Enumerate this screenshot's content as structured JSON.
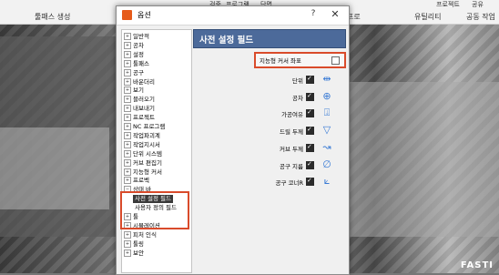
{
  "background": {
    "ribbon": {
      "group_left": "툴패스 생성",
      "tabs_top": [
        "검증",
        "프로그램",
        "단면"
      ],
      "group_mid": "프로",
      "group_right": "유틸리티",
      "right_top": "프로젝트",
      "right_top2": "공유",
      "group_far_right": "공동 작업"
    },
    "logo": "FASTI"
  },
  "dialog": {
    "title": "옵션",
    "help_label": "?",
    "close_label": "✕",
    "tree": {
      "items": [
        {
          "label": "일반적",
          "expander": "+"
        },
        {
          "label": "공차",
          "expander": "+"
        },
        {
          "label": "설정",
          "expander": "+"
        },
        {
          "label": "툴패스",
          "expander": "+"
        },
        {
          "label": "공구",
          "expander": "+"
        },
        {
          "label": "바운더리",
          "expander": "+"
        },
        {
          "label": "보기",
          "expander": "+"
        },
        {
          "label": "블러오기",
          "expander": "+"
        },
        {
          "label": "내보내기",
          "expander": "+"
        },
        {
          "label": "프로젝트",
          "expander": "+"
        },
        {
          "label": "NC 프로그램",
          "expander": "+"
        },
        {
          "label": "작업파괴계",
          "expander": "+"
        },
        {
          "label": "작업지시서",
          "expander": "+"
        },
        {
          "label": "단위 시스템",
          "expander": "+"
        },
        {
          "label": "커브 편집기",
          "expander": "+"
        },
        {
          "label": "지능형 커서",
          "expander": "+"
        },
        {
          "label": "프로벡",
          "expander": "+"
        },
        {
          "label": "상태 바",
          "expander": "−"
        }
      ],
      "status_children": [
        "사전 설정 필드",
        "사용자 정의 필드"
      ],
      "after_items": [
        {
          "label": "툴",
          "expander": "+"
        },
        {
          "label": "시뮬레이션",
          "expander": "+"
        },
        {
          "label": "피처 인식",
          "expander": "+"
        },
        {
          "label": "툴링",
          "expander": "+"
        },
        {
          "label": "보안",
          "expander": "+"
        }
      ]
    },
    "panel": {
      "header": "사전 설정 필드",
      "cursor_coord": {
        "label": "지능형 커서 좌표",
        "checked": false
      },
      "fields": [
        {
          "label": "단위",
          "checked": true,
          "icon": "ruler-icon",
          "glyph": "⇹"
        },
        {
          "label": "공차",
          "checked": true,
          "icon": "crosshair-icon",
          "glyph": "⊕"
        },
        {
          "label": "가공여유",
          "checked": true,
          "icon": "stock-icon",
          "glyph": "⍗"
        },
        {
          "label": "드릴 두께",
          "checked": true,
          "icon": "drill-icon",
          "glyph": "▽"
        },
        {
          "label": "커브 두께",
          "checked": true,
          "icon": "curve-icon",
          "glyph": "↝"
        },
        {
          "label": "공구 지름",
          "checked": true,
          "icon": "tool-diameter-icon",
          "glyph": "∅"
        },
        {
          "label": "공구 코너R",
          "checked": true,
          "icon": "corner-radius-icon",
          "glyph": "⟀"
        }
      ]
    }
  }
}
